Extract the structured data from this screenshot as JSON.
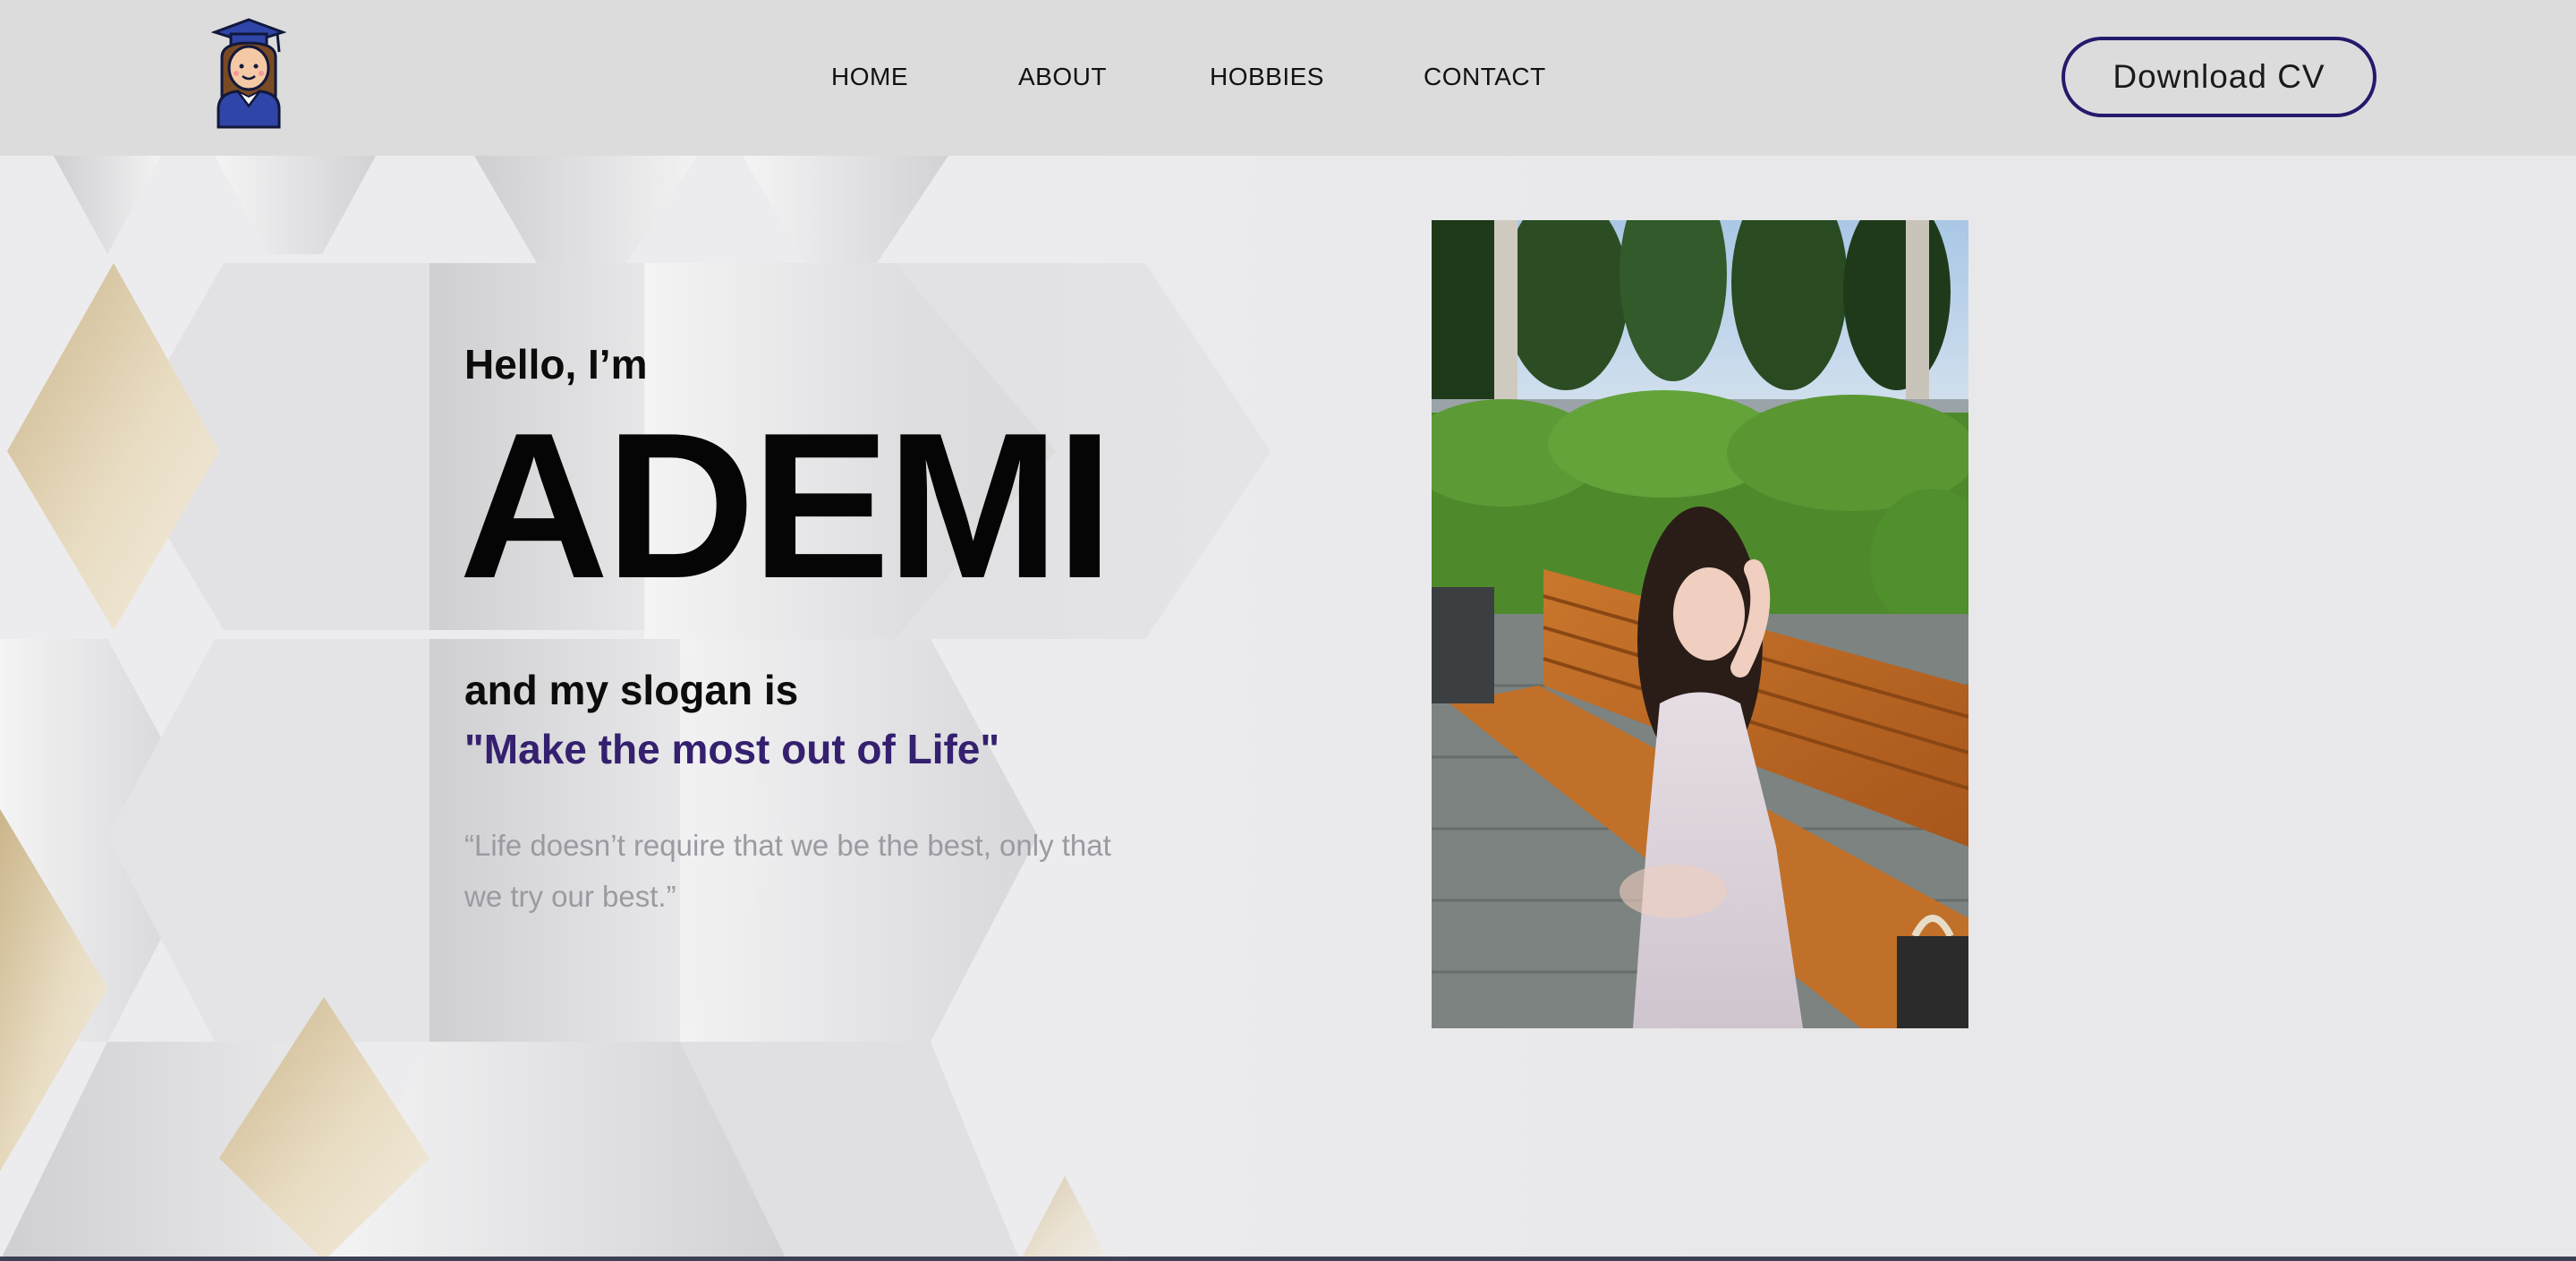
{
  "header": {
    "logo_icon": "graduate-avatar-icon",
    "nav": {
      "home": "HOME",
      "about": "ABOUT",
      "hobbies": "HOBBIES",
      "contact": "CONTACT"
    },
    "cv_button_label": "Download CV"
  },
  "hero": {
    "greeting": "Hello, I’m",
    "name": "ADEMI",
    "slogan_intro": "and my slogan is",
    "slogan": "\"Make the most out of Life\"",
    "quote": "“Life doesn’t require that we be the best, only that we try our best.”"
  },
  "photo": {
    "icon": "portrait-photo"
  },
  "colors": {
    "header_bg": "#dcdcdd",
    "accent": "#35206f",
    "button_border": "#231a6b",
    "quote_text": "#9a9aa2",
    "gold_diamond": "#d9c49e"
  }
}
